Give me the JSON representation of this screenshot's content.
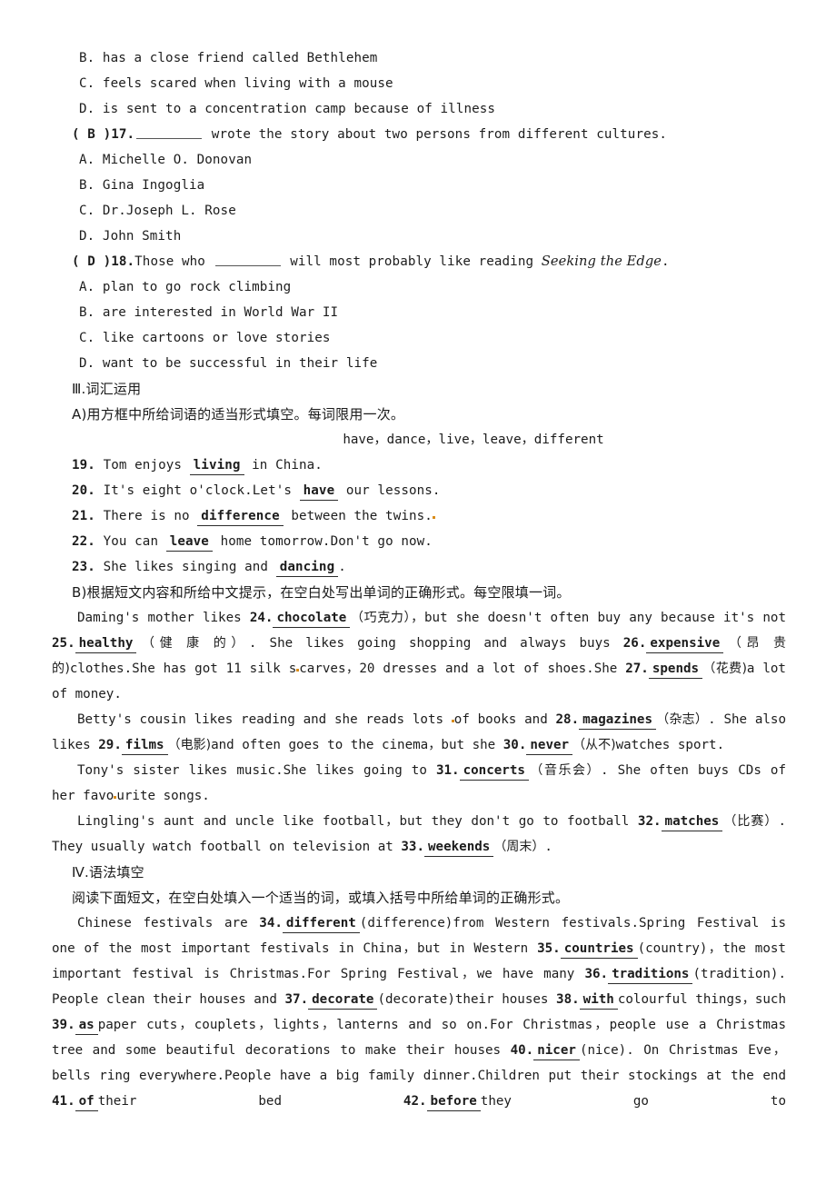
{
  "document": {
    "type": "english-exam-worksheet",
    "language_mix": "english-chinese"
  },
  "reading_options_q16": [
    "B. has a close friend called Bethlehem",
    "C. feels scared when living with a mouse",
    "D. is sent to a concentration camp because of illness"
  ],
  "question_17": {
    "answer_tag": "( B )",
    "number": "17.",
    "text_after_blank": " wrote the story about two persons from different cultures.",
    "options": [
      "A. Michelle O. Donovan",
      "B. Gina Ingoglia",
      "C. Dr.Joseph L. Rose",
      "D. John Smith"
    ]
  },
  "question_18": {
    "answer_tag": "( D )",
    "number": "18.",
    "text_before_blank": "Those who ",
    "text_after_blank": " will most probably like reading ",
    "book_title": "Seeking the Edge",
    "trailing": ".",
    "options": [
      "A. plan to go rock climbing",
      "B. are interested in World War II",
      "C. like cartoons or love stories",
      "D. want to be successful in their life"
    ]
  },
  "section_3": {
    "heading": "Ⅲ.词汇运用",
    "part_a_instruction": "A)用方框中所给词语的适当形式填空。每词限用一次。",
    "word_bank": "have，dance，live，leave，different",
    "items": [
      {
        "number": "19.",
        "before": "Tom enjoys ",
        "answer": "living",
        "after": " in China."
      },
      {
        "number": "20.",
        "before": "It's eight o'clock.Let's ",
        "answer": "have",
        "after": " our lessons."
      },
      {
        "number": "21.",
        "before": "There is no ",
        "answer": "difference",
        "after": " between the twins."
      },
      {
        "number": "22.",
        "before": "You can ",
        "answer": "leave",
        "after": " home tomorrow.Don't go now."
      },
      {
        "number": "23.",
        "before": "She likes singing and ",
        "answer": "dancing",
        "after": "."
      }
    ],
    "part_b_instruction": "B)根据短文内容和所给中文提示，在空白处写出单词的正确形式。每空限填一词。",
    "passage_b": {
      "p1": {
        "t1": "Daming's mother likes ",
        "n24": "24.",
        "a24": "chocolate",
        "h24": "（巧克力）",
        "t2": "，but she doesn't often buy any because it's not ",
        "n25": "25.",
        "a25": "healthy",
        "h25": "（健 康 的）",
        "t3": ". She likes going shopping and always buys ",
        "n26": "26.",
        "a26": "expensive",
        "h26": "（昂 贵 的)",
        "t4": "clothes.She has got 11 silk s",
        "t5": "carves，20 dresses and a lot of shoes.She ",
        "n27": "27.",
        "a27": "spends",
        "h27": "（花费)",
        "t6": "a lot of money."
      },
      "p2": {
        "t1": "Betty's cousin likes reading and she reads lots ",
        "t2": "of books and ",
        "n28": "28.",
        "a28": "magazines",
        "h28": "（杂志）",
        "t3": ". She also likes ",
        "n29": "29.",
        "a29": "films",
        "h29": "（电影)",
        "t4": "and often goes to the cinema，but she ",
        "n30": "30.",
        "a30": "never",
        "h30": "（从不)",
        "t5": "watches sport."
      },
      "p3": {
        "t1": "Tony's sister likes music.She likes going to ",
        "n31": "31.",
        "a31": "concerts",
        "h31": "（音乐会）",
        "t2": ". She often buys CDs of her favo",
        "t3": "urite songs."
      },
      "p4": {
        "t1": "Lingling's aunt and uncle like football，but they don't go to football ",
        "n32": "32.",
        "a32": "matches",
        "h32": "（比赛）",
        "t2": ". They usually watch football on television at ",
        "n33": "33.",
        "a33": "weekends",
        "h33": "（周末）",
        "t3": "."
      }
    }
  },
  "section_4": {
    "heading": "Ⅳ.语法填空",
    "instruction": "阅读下面短文，在空白处填入一个适当的词，或填入括号中所给单词的正确形式。",
    "passage": {
      "t1": "Chinese festivals are ",
      "n34": "34.",
      "a34": "different",
      "h34": "(difference)",
      "t2": "from Western festivals.Spring Festival is one of the most important festivals in China，but in Western ",
      "n35": "35.",
      "a35": "countries",
      "h35": "(country)",
      "t3": "，the most important festival is Christmas.For Spring Festival，we have many ",
      "n36": "36.",
      "a36": "traditions",
      "h36": "(tradition)",
      "t4": ". People clean their houses and ",
      "n37": "37.",
      "a37": "decorate",
      "h37": "(decorate)",
      "t5": "their houses ",
      "n38": "38.",
      "a38": "with",
      "h38": "",
      "t6": "colourful things，such ",
      "n39": "39.",
      "a39": "as",
      "h39": "",
      "t7": "paper cuts，couplets，lights，lanterns and so on.For Christmas，people use a Christmas tree and some beautiful decorations to make their houses ",
      "n40": "40.",
      "a40": "nicer",
      "h40": "(nice)",
      "t8": ". On Christmas Eve，bells ring everywhere.People have a big family dinner.Children put their stockings at the end ",
      "n41": "41.",
      "a41": "of",
      "h41": "",
      "t9": "their bed ",
      "n42": "42.",
      "a42": "before",
      "h42": "",
      "t10": "they go to"
    }
  }
}
